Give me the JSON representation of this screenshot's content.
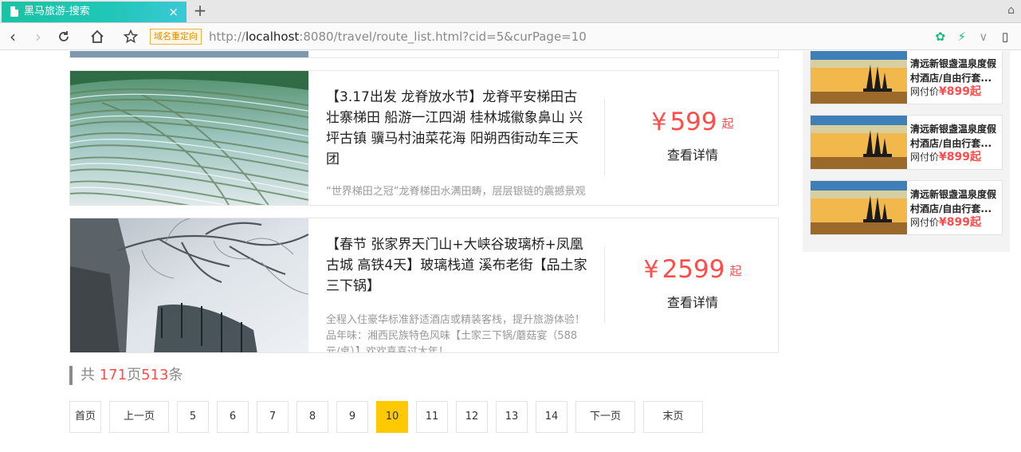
{
  "browser": {
    "tab_title": "黑马旅游-搜索",
    "tab_close": "×",
    "new_tab": "+",
    "redirect_badge": "域名重定向",
    "url_scheme": "http://",
    "url_host": "localhost",
    "url_rest": ":8080/travel/route_list.html?cid=5&curPage=10"
  },
  "routes": [
    {
      "title": "【3.17出发 龙脊放水节】龙脊平安梯田古壮寨梯田 船游一江四湖 桂林城徽象鼻山 兴坪古镇 骥马村油菜花海 阳朔西街动车三天团",
      "desc": "“世界梯田之冠”龙脊梯田水满田畴，层层银链的震撼景观",
      "price": "599",
      "yen": "¥",
      "price_suffix": "起",
      "detail": "查看详情"
    },
    {
      "title": "【春节 张家界天门山+大峡谷玻璃桥+凤凰古城 高铁4天】玻璃栈道 溪布老街【品土家三下锅】",
      "desc": "全程入住豪华标准舒适酒店或精装客栈，提升旅游体验！品年味：湘西民族特色风味【土家三下锅/蘑菇宴（588元/桌）】欢欢喜喜过大年！",
      "price": "2599",
      "yen": "¥",
      "price_suffix": "起",
      "detail": "查看详情"
    }
  ],
  "paging": {
    "prefix": "共",
    "total_pages": "171",
    "pages_unit": "页",
    "total_records": "513",
    "records_unit": "条",
    "buttons": [
      "首页",
      "上一页",
      "5",
      "6",
      "7",
      "8",
      "9",
      "10",
      "11",
      "12",
      "13",
      "14",
      "下一页",
      "末页"
    ],
    "current": "10"
  },
  "sidebar": {
    "items": [
      {
        "title": "清远新银盏温泉度假村酒店/自由行套...",
        "price_label": "网付价",
        "price": "¥899起"
      },
      {
        "title": "清远新银盏温泉度假村酒店/自由行套...",
        "price_label": "网付价",
        "price": "¥899起"
      },
      {
        "title": "清远新银盏温泉度假村酒店/自由行套...",
        "price_label": "网付价",
        "price": "¥899起"
      }
    ]
  },
  "colors": {
    "accent_price": "#ff4c4c",
    "pager_current": "#ffc900",
    "tab_gradient_start": "#19c3a3",
    "tab_gradient_end": "#3bc9d6"
  },
  "icons": [
    "back-icon",
    "forward-icon",
    "reload-icon",
    "home-icon",
    "bookmark-star-icon",
    "extension-icon",
    "lightning-icon",
    "menu-chevron-icon",
    "device-icon",
    "document-icon"
  ]
}
